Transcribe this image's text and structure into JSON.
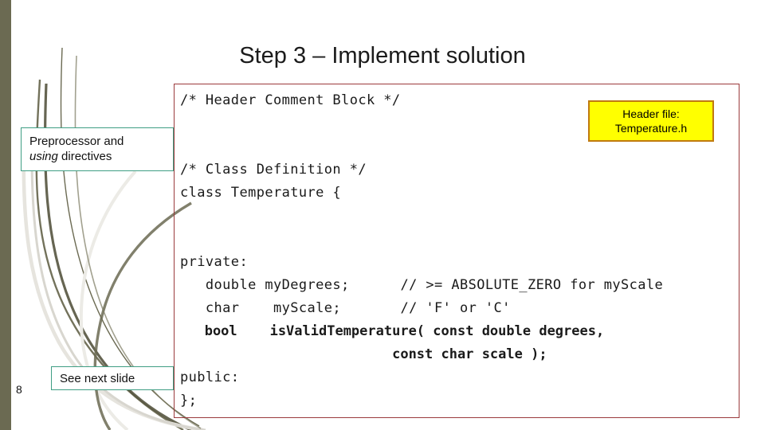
{
  "slide": {
    "title": "Step 3 – Implement solution",
    "page_number": "8"
  },
  "colors": {
    "left_bar": "#6b6a52",
    "code_border": "#9b3a3c",
    "callout_border_teal": "#3f9e84",
    "callout_yellow_fill": "#ffff00",
    "callout_yellow_border": "#c07a10",
    "swoosh_dark": "#6b6a52",
    "swoosh_light": "#e6e4de",
    "text": "#1a1a1a"
  },
  "code_panel": {
    "lines": [
      "/* Header Comment Block */",
      "",
      "",
      "/* Class Definition */",
      "class Temperature {",
      "",
      "",
      "private:",
      "   double myDegrees;      // >= ABSOLUTE_ZERO for myScale",
      "   char    myScale;       // 'F' or 'C'",
      "   bool    isValidTemperature( const double degrees,",
      "                          const char scale );",
      "public:",
      "};"
    ],
    "bold_line_indices": [
      10,
      11
    ]
  },
  "callouts": {
    "header_file": {
      "line1": "Header file:",
      "line2": "Temperature.h"
    },
    "preprocessor": {
      "prefix": "Preprocessor and",
      "emphasis": "using",
      "suffix": " directives"
    },
    "see_next_slide": {
      "label": "See next slide"
    }
  }
}
